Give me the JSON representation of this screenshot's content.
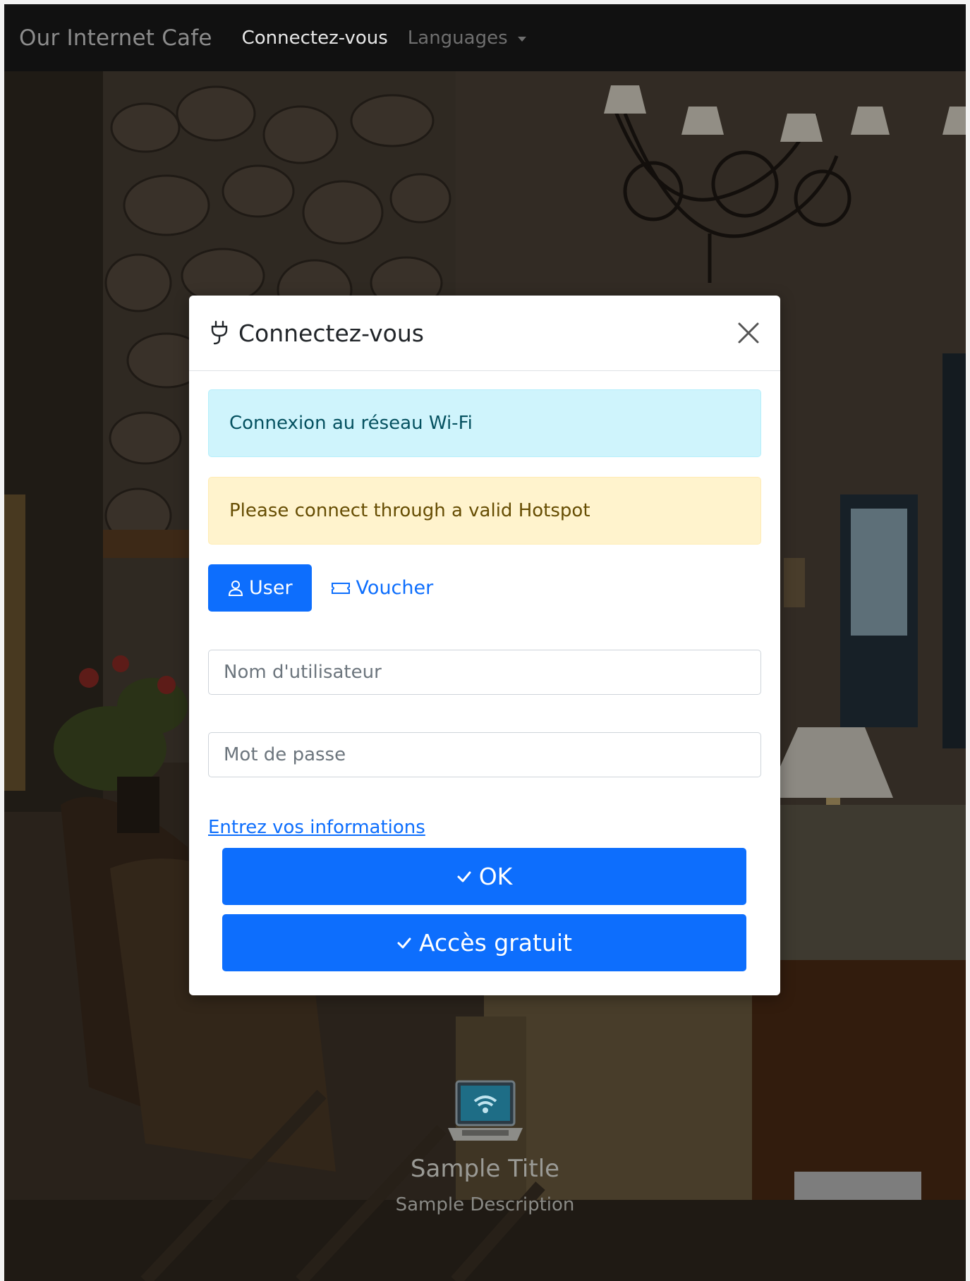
{
  "navbar": {
    "brand": "Our Internet Cafe",
    "login_link": "Connectez-vous",
    "languages_label": "Languages"
  },
  "modal": {
    "title": "Connectez-vous",
    "title_icon": "plug-icon",
    "close_icon": "close-icon",
    "info_alert": "Connexion au réseau Wi-Fi",
    "warning_alert": "Please connect through a valid Hotspot",
    "tabs": [
      {
        "label": "User",
        "icon": "user-icon",
        "active": true
      },
      {
        "label": "Voucher",
        "icon": "ticket-icon",
        "active": false
      }
    ],
    "username_placeholder": "Nom d'utilisateur",
    "password_placeholder": "Mot de passe",
    "info_link": "Entrez vos informations",
    "ok_button": "OK",
    "free_access_button": "Accès gratuit"
  },
  "widget": {
    "icon": "laptop-wifi-icon",
    "title": "Sample Title",
    "description": "Sample Description"
  },
  "colors": {
    "primary": "#0d6efd",
    "navbar_bg": "#111111",
    "info_bg": "#cff4fc",
    "warning_bg": "#fff3cd"
  }
}
